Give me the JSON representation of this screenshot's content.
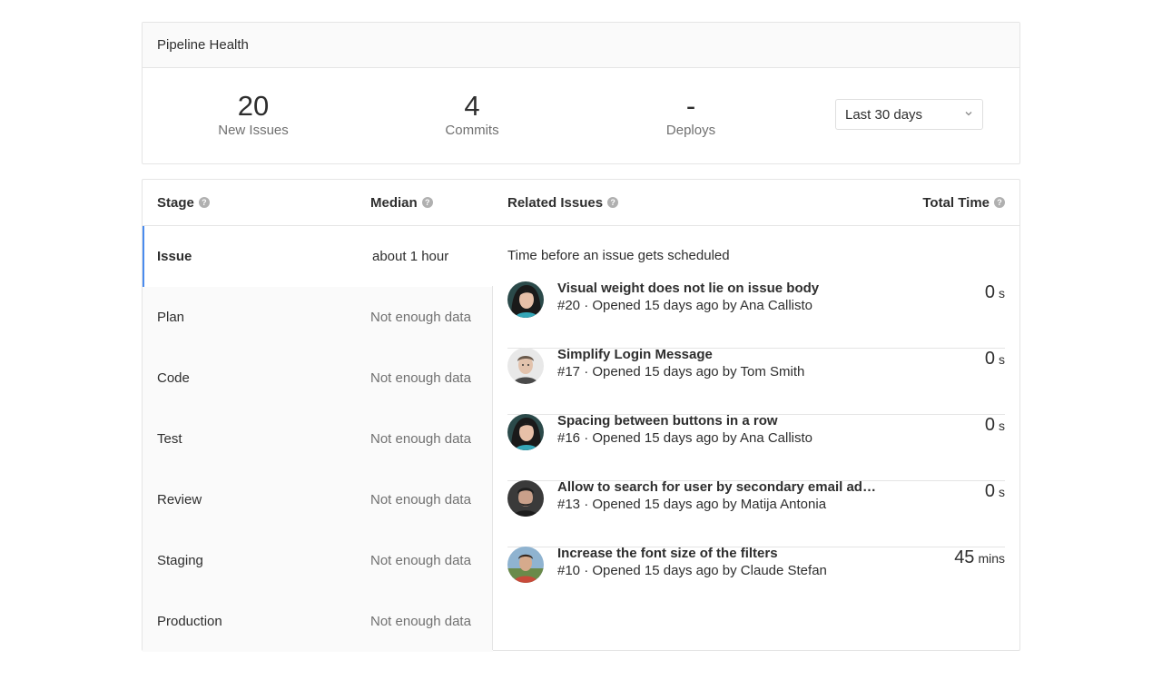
{
  "health": {
    "title": "Pipeline Health",
    "stats": [
      {
        "value": "20",
        "label": "New Issues"
      },
      {
        "value": "4",
        "label": "Commits"
      },
      {
        "value": "-",
        "label": "Deploys"
      }
    ],
    "range_select": {
      "value": "Last 30 days"
    }
  },
  "table": {
    "headers": {
      "stage": "Stage",
      "median": "Median",
      "related": "Related Issues",
      "total": "Total Time"
    },
    "stages": [
      {
        "name": "Issue",
        "median": "about 1 hour",
        "active": true
      },
      {
        "name": "Plan",
        "median": "Not enough data"
      },
      {
        "name": "Code",
        "median": "Not enough data"
      },
      {
        "name": "Test",
        "median": "Not enough data"
      },
      {
        "name": "Review",
        "median": "Not enough data"
      },
      {
        "name": "Staging",
        "median": "Not enough data"
      },
      {
        "name": "Production",
        "median": "Not enough data"
      }
    ],
    "description": "Time before an issue gets scheduled",
    "issues": [
      {
        "title": "Visual weight does not lie on issue body",
        "meta": "#20 · Opened 15 days ago by Ana Callisto",
        "time": "0",
        "unit": "s",
        "avatar": "avatar-woman"
      },
      {
        "title": "Simplify Login Message",
        "meta": "#17 · Opened 15 days ago by Tom Smith",
        "time": "0",
        "unit": "s",
        "avatar": "avatar-man-light"
      },
      {
        "title": "Spacing between buttons in a row",
        "meta": "#16 · Opened 15 days ago by Ana Callisto",
        "time": "0",
        "unit": "s",
        "avatar": "avatar-woman"
      },
      {
        "title": "Allow to search for user by secondary email addre...",
        "meta": "#13 · Opened 15 days ago by Matija Antonia",
        "time": "0",
        "unit": "s",
        "avatar": "avatar-man-dark"
      },
      {
        "title": "Increase the font size of the filters",
        "meta": "#10 · Opened 15 days ago by Claude Stefan",
        "time": "45",
        "unit": "mins",
        "avatar": "avatar-man-outdoor"
      }
    ]
  }
}
